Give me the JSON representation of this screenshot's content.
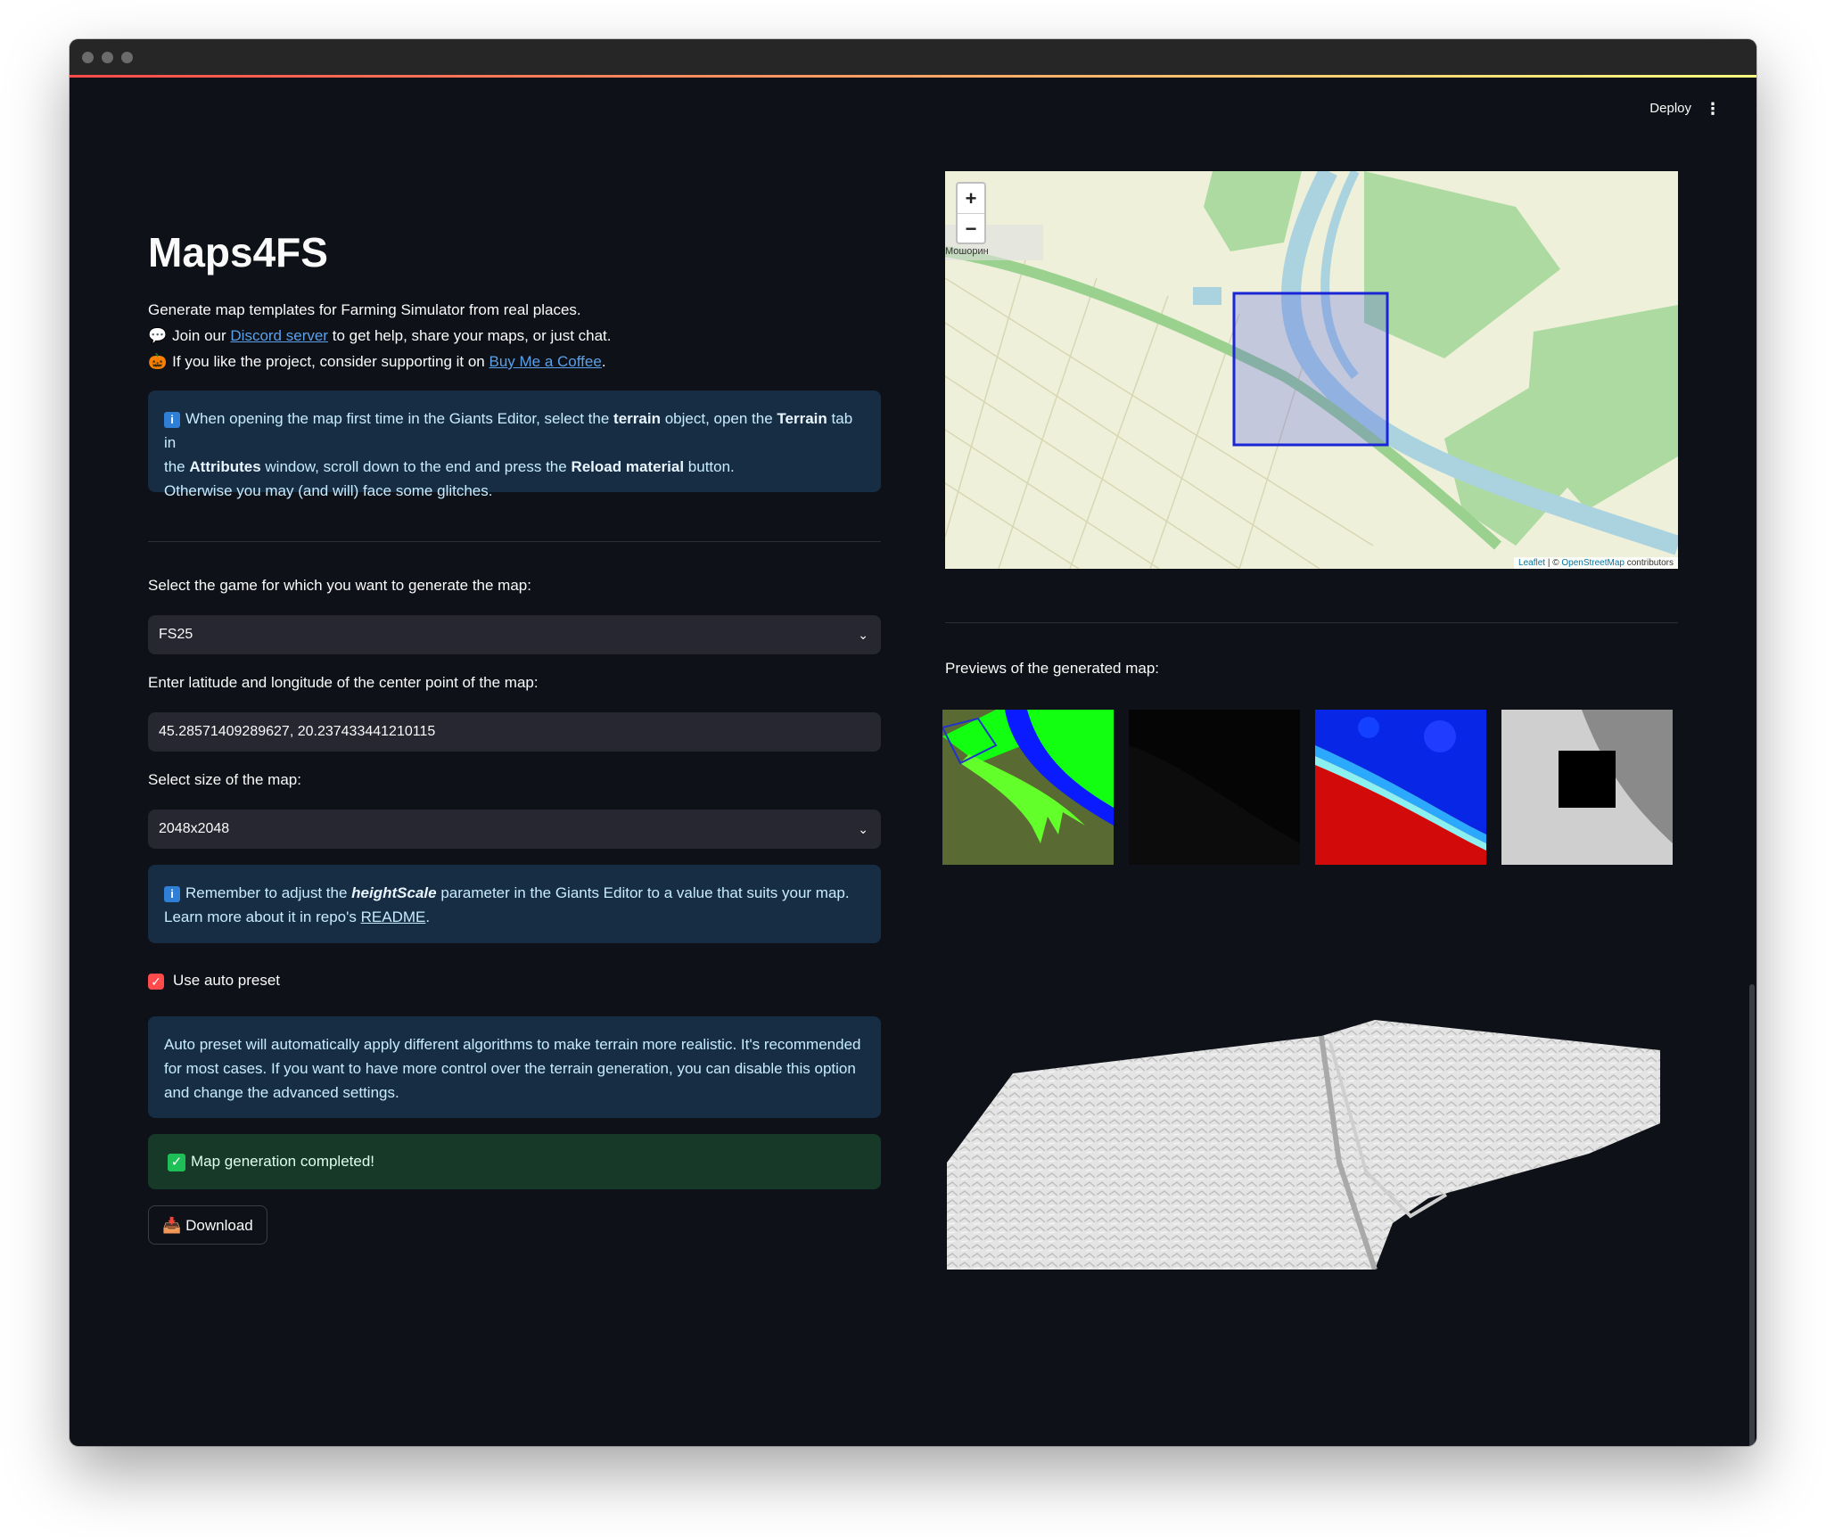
{
  "header": {
    "deploy_label": "Deploy",
    "menu_icon": "kebab-menu-icon"
  },
  "main": {
    "title": "Maps4FS",
    "intro": "Generate map templates for Farming Simulator from real places.",
    "discord": {
      "prefix": "Join our",
      "link": "Discord server",
      "suffix": "to get help, share your maps, or just chat.",
      "icon": "speech-bubble-icon"
    },
    "coffee": {
      "prefix": "If you like the project, consider supporting it on",
      "link": "Buy Me a Coffee",
      "suffix": ".",
      "icon": "pumpkin-icon"
    },
    "editor_info": {
      "p1": "When opening the map first time in the Giants Editor, select the",
      "b1": "terrain",
      "p2": "object, open the",
      "b2": "Terrain",
      "p3": "tab in",
      "p4": "the",
      "b3": "Attributes",
      "p5": "window, scroll down to the end and press the",
      "b4": "Reload material",
      "p6": "button.",
      "line3": "Otherwise you may (and will) face some glitches."
    },
    "game_label": "Select the game for which you want to generate the map:",
    "game_value": "FS25",
    "coords_label": "Enter latitude and longitude of the center point of the map:",
    "coords_value": "45.28571409289627, 20.237433441210115",
    "size_label": "Select size of the map:",
    "size_value": "2048x2048",
    "height_info": {
      "p1": "Remember to adjust the",
      "bi": "heightScale",
      "p2": "parameter in the Giants Editor to a value that suits your map.",
      "p3": "Learn more about it in repo's",
      "link": "README",
      "p4": "."
    },
    "auto_preset_label": "Use auto preset",
    "auto_preset_checked": true,
    "auto_preset_info": {
      "l1": "Auto preset will automatically apply different algorithms to make terrain more realistic. It's recommended",
      "l2": "for most cases. If you want to have more control over the terrain generation, you can disable this option",
      "l3": "and change the advanced settings."
    },
    "success_message": "Map generation completed!",
    "download_label": "Download"
  },
  "map": {
    "zoom_in": "+",
    "zoom_out": "−",
    "place_label": "Мошорин",
    "attribution_leaflet": "Leaflet",
    "attribution_sep": "| ©",
    "attribution_osm": "OpenStreetMap",
    "attribution_contrib": "contributors"
  },
  "previews": {
    "label": "Previews of the generated map:"
  },
  "colors": {
    "accent": "#ff4b4b",
    "info_bg": "#172d43",
    "success_bg": "#173928",
    "bg": "#0e1117"
  }
}
